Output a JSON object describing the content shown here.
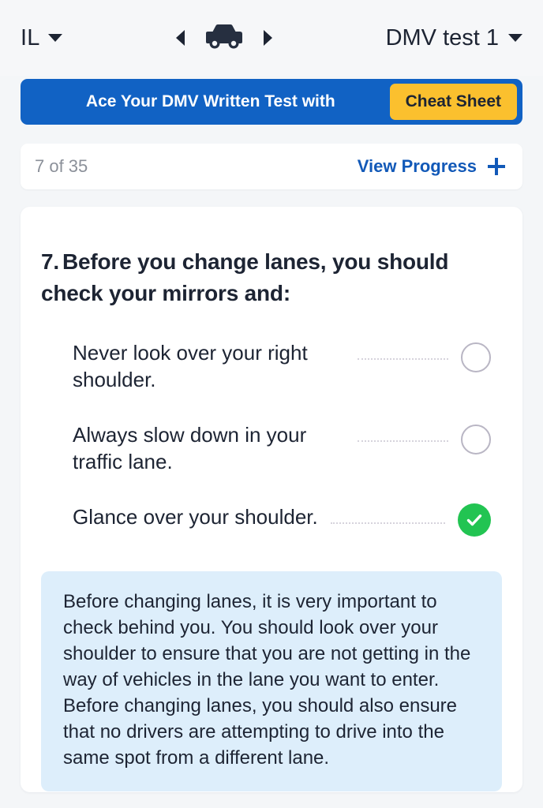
{
  "topbar": {
    "state_label": "IL",
    "state_caret_icon": "chevron-down-icon",
    "prev_icon": "chevron-left-icon",
    "vehicle_icon": "car-icon",
    "next_icon": "chevron-right-icon",
    "test_label": "DMV test 1",
    "test_caret_icon": "chevron-down-icon"
  },
  "promo": {
    "text": "Ace Your DMV Written Test with",
    "button_label": "Cheat Sheet",
    "banner_color": "#1162c4",
    "button_color": "#fbc02e"
  },
  "progress": {
    "count_label": "7 of 35",
    "current": 7,
    "total": 35,
    "view_label": "View Progress",
    "plus_icon": "plus-icon",
    "link_color": "#1259b8"
  },
  "question": {
    "number": "7.",
    "text": "Before you change lanes, you should check your mirrors and:",
    "options": [
      {
        "text": "Never look over your right shoulder.",
        "state": "unselected",
        "icon": "radio-empty-icon"
      },
      {
        "text": "Always slow down in your traffic lane.",
        "state": "unselected",
        "icon": "radio-empty-icon"
      },
      {
        "text": "Glance over your shoulder.",
        "state": "correct",
        "icon": "check-circle-icon"
      }
    ],
    "correct_color": "#22c452",
    "explanation": "Before changing lanes, it is very important to check behind you. You should look over your shoulder to ensure that you are not getting in the way of vehicles in the lane you want to enter. Before changing lanes, you should also ensure that no drivers are attempting to drive into the same spot from a different lane.",
    "explanation_bg": "#ddeefb"
  }
}
